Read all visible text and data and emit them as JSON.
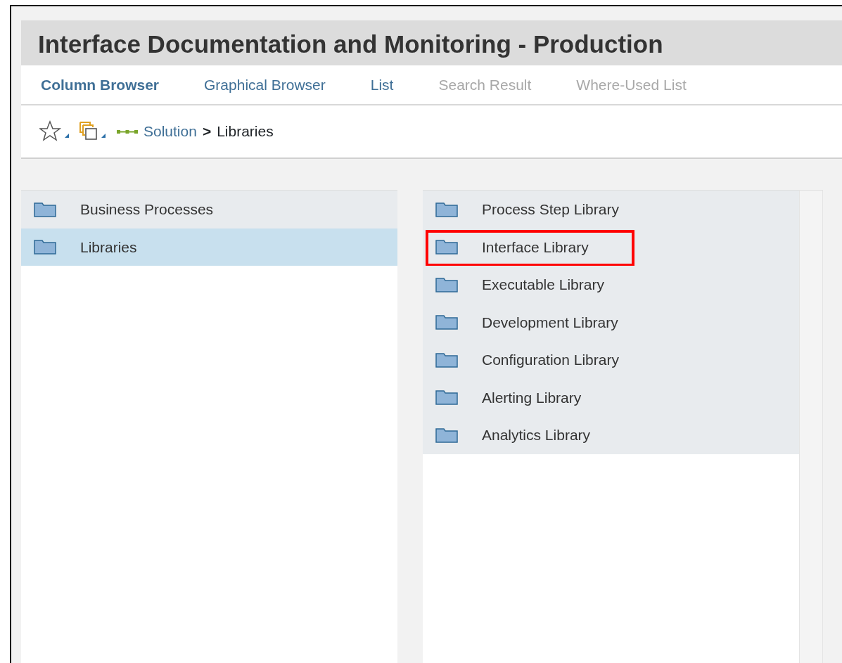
{
  "window": {
    "title": "Interface Documentation and Monitoring - Production"
  },
  "tabs": [
    {
      "label": "Column Browser",
      "selected": true,
      "disabled": false
    },
    {
      "label": "Graphical Browser",
      "selected": false,
      "disabled": false
    },
    {
      "label": "List",
      "selected": false,
      "disabled": false
    },
    {
      "label": "Search Result",
      "selected": false,
      "disabled": true
    },
    {
      "label": "Where-Used List",
      "selected": false,
      "disabled": true
    }
  ],
  "breadcrumb": {
    "link": "Solution",
    "separator": ">",
    "current": "Libraries"
  },
  "columns": [
    {
      "items": [
        {
          "label": "Business Processes",
          "selected": false,
          "highlighted": false
        },
        {
          "label": "Libraries",
          "selected": true,
          "highlighted": false
        }
      ]
    },
    {
      "items": [
        {
          "label": "Process Step Library",
          "selected": false,
          "highlighted": false
        },
        {
          "label": "Interface Library",
          "selected": false,
          "highlighted": true
        },
        {
          "label": "Executable Library",
          "selected": false,
          "highlighted": false
        },
        {
          "label": "Development Library",
          "selected": false,
          "highlighted": false
        },
        {
          "label": "Configuration Library",
          "selected": false,
          "highlighted": false
        },
        {
          "label": "Alerting Library",
          "selected": false,
          "highlighted": false
        },
        {
          "label": "Analytics Library",
          "selected": false,
          "highlighted": false
        }
      ]
    }
  ]
}
